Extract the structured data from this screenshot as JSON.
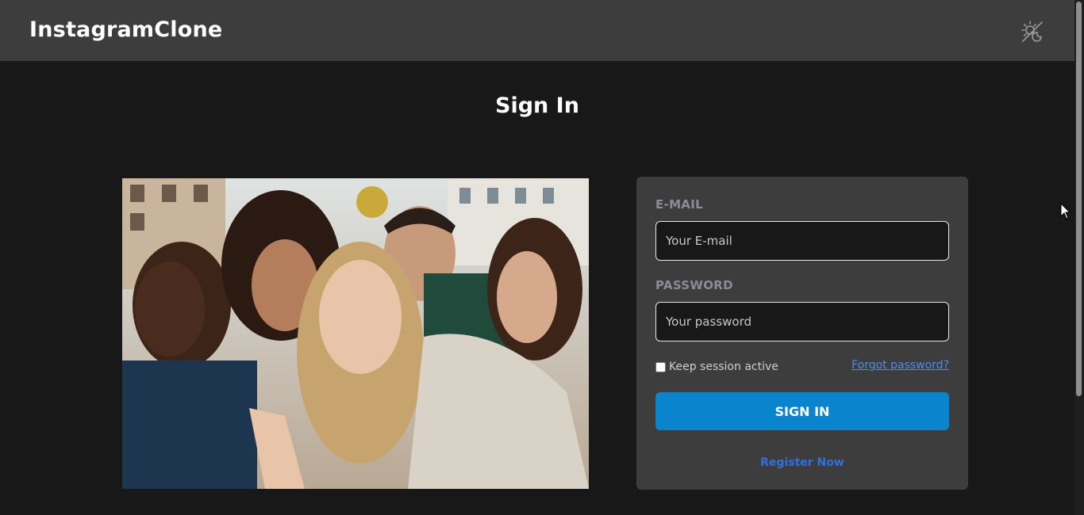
{
  "header": {
    "brand": "InstagramClone",
    "theme_toggle_icon": "sun-moon-icon"
  },
  "main": {
    "title": "Sign In",
    "hero_image": {
      "description_icon": "group-selfie-photo"
    }
  },
  "signin_form": {
    "email_label": "E-MAIL",
    "email_placeholder": "Your E-mail",
    "email_value": "",
    "password_label": "PASSWORD",
    "password_placeholder": "Your password",
    "password_value": "",
    "remember_label": "Keep session active",
    "remember_checked": false,
    "forgot_label": "Forgot password?",
    "submit_label": "SIGN IN",
    "register_label": "Register Now"
  },
  "colors": {
    "background": "#181818",
    "header": "#3d3d3d",
    "card": "#3d3d3d",
    "primary_button": "#0a84cc",
    "link": "#4f8cf0"
  }
}
